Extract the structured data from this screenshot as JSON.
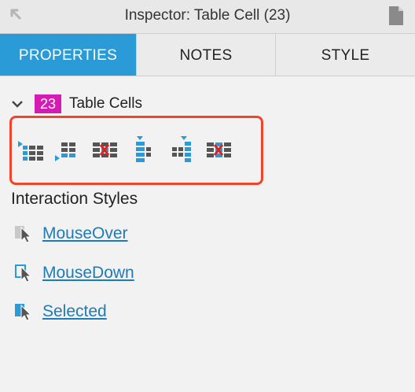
{
  "titlebar": {
    "title": "Inspector: Table Cell (23)",
    "left_icon": "back-arrow-icon",
    "right_icon": "document-icon"
  },
  "tabs": [
    {
      "label": "PROPERTIES",
      "active": true
    },
    {
      "label": "NOTES",
      "active": false
    },
    {
      "label": "STYLE",
      "active": false
    }
  ],
  "section": {
    "count": "23",
    "title": "Table Cells",
    "badge_color": "#d41cb4"
  },
  "tools": [
    {
      "name": "insert-column-left-icon"
    },
    {
      "name": "insert-column-right-icon"
    },
    {
      "name": "delete-column-icon"
    },
    {
      "name": "insert-row-above-icon"
    },
    {
      "name": "insert-row-below-icon"
    },
    {
      "name": "delete-row-icon"
    }
  ],
  "interaction": {
    "title": "Interaction Styles",
    "items": [
      {
        "label": "MouseOver"
      },
      {
        "label": "MouseDown"
      },
      {
        "label": "Selected"
      }
    ]
  },
  "colors": {
    "accent": "#2a9bd6",
    "highlight_border": "#f0452a",
    "link": "#1f7bb6"
  }
}
